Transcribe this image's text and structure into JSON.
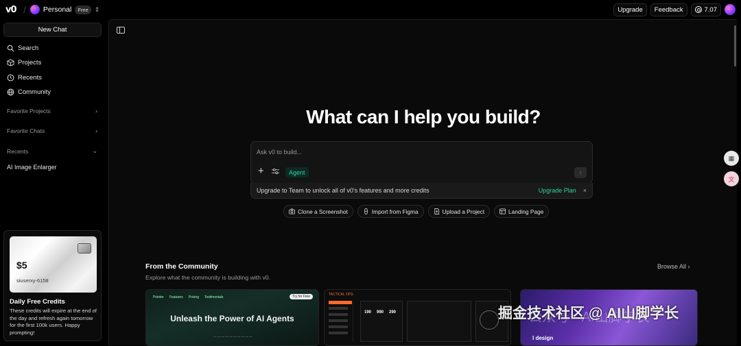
{
  "topbar": {
    "logo": "v0",
    "workspace_name": "Personal",
    "plan_badge": "Free",
    "upgrade_label": "Upgrade",
    "feedback_label": "Feedback",
    "credits_value": "7.07"
  },
  "sidebar": {
    "new_chat_label": "New Chat",
    "nav": [
      {
        "label": "Search",
        "icon": "search-icon"
      },
      {
        "label": "Projects",
        "icon": "box-icon"
      },
      {
        "label": "Recents",
        "icon": "clock-icon"
      },
      {
        "label": "Community",
        "icon": "globe-icon"
      }
    ],
    "sections": [
      {
        "label": "Favorite Projects",
        "chevron": "›"
      },
      {
        "label": "Favorite Chats",
        "chevron": "›"
      },
      {
        "label": "Recents",
        "chevron": "⌄"
      }
    ],
    "recent_item": "AI Image Enlarger",
    "credits_card": {
      "amount": "$5",
      "username": "siuserxy-6158",
      "title": "Daily Free Credits",
      "text": "These credits will expire at the end of the day and refresh again tomorrow for the first 100k users. Happy prompting!"
    }
  },
  "main": {
    "headline": "What can I help you build?",
    "prompt_placeholder": "Ask v0 to build...",
    "agent_label": "Agent",
    "upgrade_bar_text": "Upgrade to Team to unlock all of v0's features and more credits",
    "upgrade_plan_label": "Upgrade Plan",
    "close_label": "×",
    "quick_actions": [
      {
        "label": "Clone a Screenshot",
        "icon": "camera-icon"
      },
      {
        "label": "Import from Figma",
        "icon": "figma-icon"
      },
      {
        "label": "Upload a Project",
        "icon": "file-upload-icon"
      },
      {
        "label": "Landing Page",
        "icon": "layout-icon"
      }
    ],
    "community": {
      "title": "From the Community",
      "subtitle": "Explore what the community is building with v0.",
      "browse_label": "Browse All",
      "cards": [
        {
          "nav": [
            "Pointer",
            "Features",
            "Pricing",
            "Testimonials"
          ],
          "pill": "Try for Free",
          "headline": "Unleash the Power of AI Agents"
        },
        {
          "header": "TACTICAL OPS",
          "numbers": [
            "190",
            "990",
            "290"
          ]
        },
        {
          "text": "l design"
        }
      ]
    }
  },
  "watermark": "公众号 · AI山脚学长",
  "watermark_overlay": "掘金技术社区 @ AI山脚学长",
  "colors": {
    "accent": "#2ed3a3",
    "background": "#0a0a0a"
  }
}
